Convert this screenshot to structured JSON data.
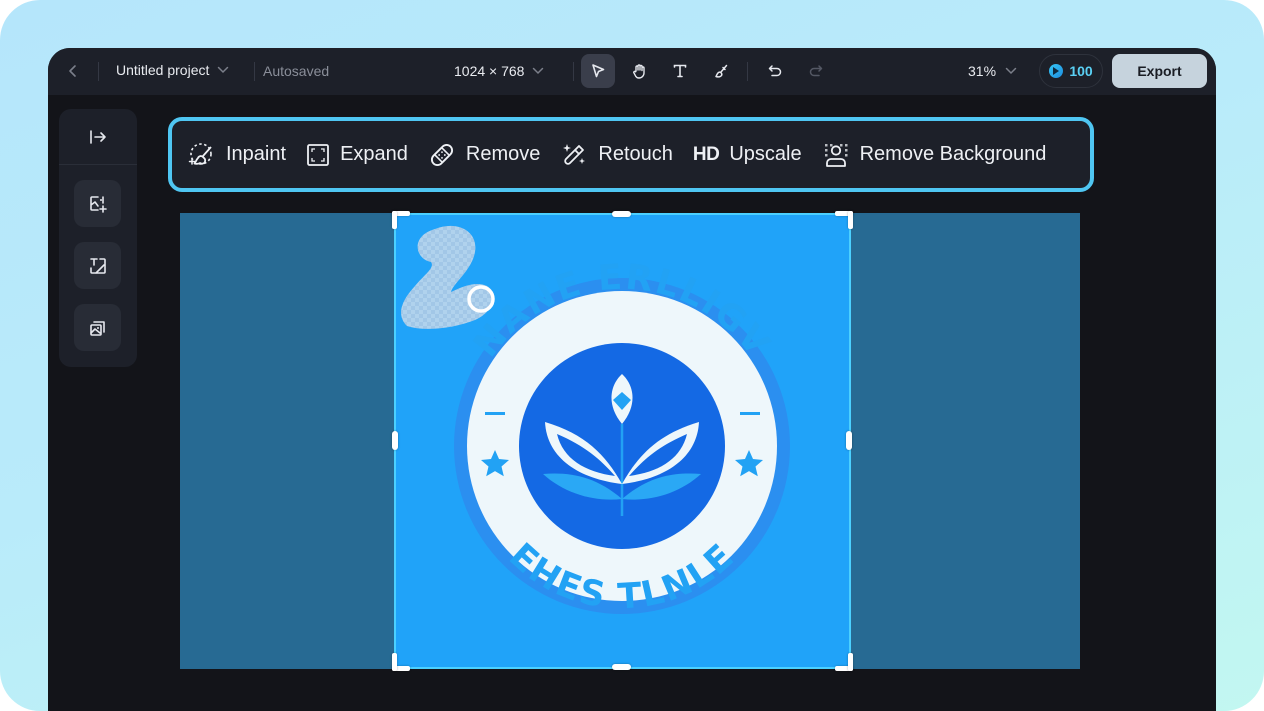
{
  "topbar": {
    "back_label": "Back",
    "project_title": "Untitled project",
    "save_status": "Autosaved",
    "canvas_size": "1024 × 768",
    "tools": [
      {
        "name": "select",
        "icon": "cursor-arrow-icon",
        "active": true
      },
      {
        "name": "hand",
        "icon": "hand-icon",
        "active": false
      },
      {
        "name": "text",
        "icon": "text-icon",
        "active": false
      },
      {
        "name": "brush",
        "icon": "brush-icon",
        "active": false
      }
    ],
    "history": [
      {
        "name": "undo",
        "icon": "undo-icon",
        "enabled": true
      },
      {
        "name": "redo",
        "icon": "redo-icon",
        "enabled": false
      }
    ],
    "zoom_level": "31%",
    "credits": "100",
    "export_label": "Export"
  },
  "left_panel": {
    "collapse_icon": "expand-panel-icon",
    "buttons": [
      {
        "name": "add-image",
        "icon": "image-add-icon"
      },
      {
        "name": "text-to-image",
        "icon": "text-image-icon"
      },
      {
        "name": "image-gallery",
        "icon": "image-stack-icon"
      }
    ]
  },
  "ai_toolbar": {
    "items": [
      {
        "label": "Inpaint",
        "icon": "inpaint-brush-icon"
      },
      {
        "label": "Expand",
        "icon": "expand-frame-icon"
      },
      {
        "label": "Remove",
        "icon": "bandage-icon"
      },
      {
        "label": "Retouch",
        "icon": "magic-wand-icon"
      },
      {
        "label": "Upscale",
        "icon": "hd-icon",
        "prefix": "HD"
      },
      {
        "label": "Remove Background",
        "icon": "person-cutout-icon"
      }
    ]
  },
  "canvas": {
    "badge_top_text": "NANE ERLLIGV",
    "badge_bottom_text": "EHES TLNLE",
    "colors": {
      "artboard": "#276a93",
      "image_bg": "#20a3f9",
      "selection": "#4bd0ff",
      "accent": "#4fc6f2"
    }
  }
}
